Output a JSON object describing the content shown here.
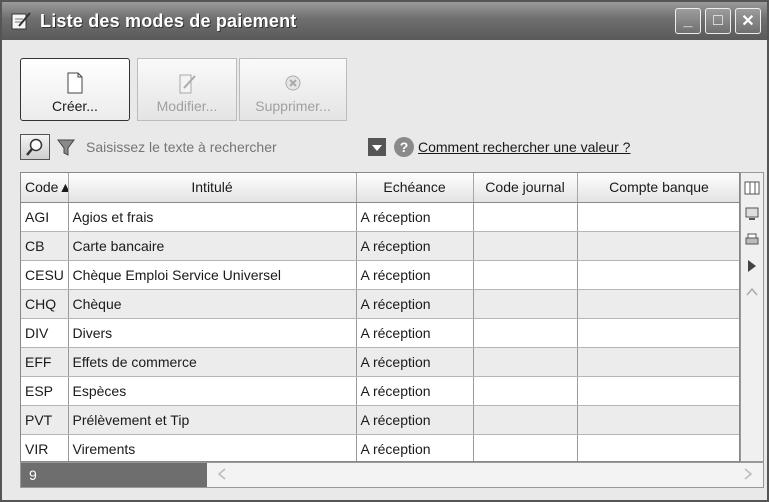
{
  "window": {
    "title": "Liste des modes de paiement",
    "controls": {
      "minimize": "_",
      "maximize": "□",
      "close": "✕"
    }
  },
  "toolbar": {
    "create_label": "Créer...",
    "modify_label": "Modifier...",
    "delete_label": "Supprimer..."
  },
  "search": {
    "placeholder": "Saisissez le texte à rechercher",
    "help_link": "Comment rechercher une valeur ?"
  },
  "table": {
    "columns": [
      "Code",
      "Intitulé",
      "Echéance",
      "Code journal",
      "Compte banque"
    ],
    "rows": [
      {
        "code": "AGI",
        "intitule": "Agios et frais",
        "echeance": "A réception",
        "journal": "",
        "compte": ""
      },
      {
        "code": "CB",
        "intitule": "Carte bancaire",
        "echeance": "A réception",
        "journal": "",
        "compte": ""
      },
      {
        "code": "CESU",
        "intitule": "Chèque Emploi Service Universel",
        "echeance": "A réception",
        "journal": "",
        "compte": ""
      },
      {
        "code": "CHQ",
        "intitule": "Chèque",
        "echeance": "A réception",
        "journal": "",
        "compte": ""
      },
      {
        "code": "DIV",
        "intitule": "Divers",
        "echeance": "A réception",
        "journal": "",
        "compte": ""
      },
      {
        "code": "EFF",
        "intitule": "Effets de commerce",
        "echeance": "A réception",
        "journal": "",
        "compte": ""
      },
      {
        "code": "ESP",
        "intitule": "Espèces",
        "echeance": "A réception",
        "journal": "",
        "compte": ""
      },
      {
        "code": "PVT",
        "intitule": "Prélèvement et Tip",
        "echeance": "A réception",
        "journal": "",
        "compte": ""
      },
      {
        "code": "VIR",
        "intitule": "Virements",
        "echeance": "A réception",
        "journal": "",
        "compte": ""
      }
    ]
  },
  "footer": {
    "count": "9"
  },
  "icons": {
    "title": "document-pencil-icon",
    "create": "new-document-icon",
    "modify": "edit-document-icon",
    "delete": "delete-icon",
    "search": "magnifier-icon",
    "filter": "funnel-icon",
    "help": "question-icon"
  }
}
